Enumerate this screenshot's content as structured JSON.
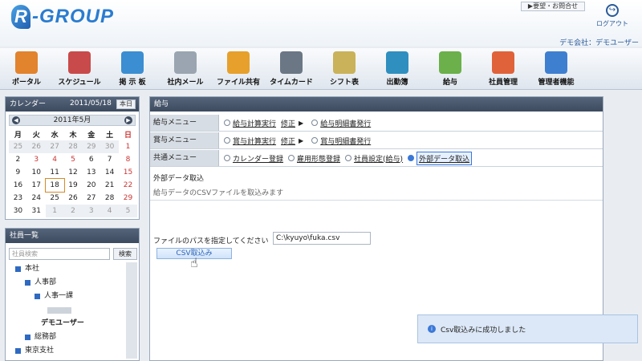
{
  "header": {
    "logo_mark": "R",
    "logo_text": "-GROUP",
    "request_link": "▶要望・お問合せ",
    "logout_label": "ログアウト",
    "company": "デモ会社：デモユーザー"
  },
  "nav": [
    {
      "label": "ポータル",
      "color": "#e2832d"
    },
    {
      "label": "スケジュール",
      "color": "#c94a4a"
    },
    {
      "label": "掲 示 板",
      "color": "#3b8ed1"
    },
    {
      "label": "社内メール",
      "color": "#9aa5b1"
    },
    {
      "label": "ファイル共有",
      "color": "#e6a02b"
    },
    {
      "label": "タイムカード",
      "color": "#6b7785"
    },
    {
      "label": "シフト表",
      "color": "#c9b25a"
    },
    {
      "label": "出勤簿",
      "color": "#2f8fbf"
    },
    {
      "label": "給与",
      "color": "#6bb04a"
    },
    {
      "label": "社員管理",
      "color": "#e0623a"
    },
    {
      "label": "管理者機能",
      "color": "#3f7fd0"
    }
  ],
  "calendar": {
    "title": "カレンダー",
    "date": "2011/05/18",
    "today_label": "本日",
    "month": "2011年5月",
    "weekdays": [
      "月",
      "火",
      "水",
      "木",
      "金",
      "土",
      "日"
    ],
    "weeks": [
      [
        "25",
        "26",
        "27",
        "28",
        "29",
        "30",
        "1"
      ],
      [
        "2",
        "3",
        "4",
        "5",
        "6",
        "7",
        "8"
      ],
      [
        "9",
        "10",
        "11",
        "12",
        "13",
        "14",
        "15"
      ],
      [
        "16",
        "17",
        "18",
        "19",
        "20",
        "21",
        "22"
      ],
      [
        "23",
        "24",
        "25",
        "26",
        "27",
        "28",
        "29"
      ],
      [
        "30",
        "31",
        "1",
        "2",
        "3",
        "4",
        "5"
      ]
    ]
  },
  "employees": {
    "title": "社員一覧",
    "search_placeholder": "社員検索",
    "search_button": "検索",
    "tree": [
      "本社",
      "人事部",
      "人事一課",
      "",
      "デモユーザー",
      "総務部",
      "東京支社"
    ]
  },
  "main": {
    "title": "給与",
    "rows": [
      {
        "label": "給与メニュー",
        "items": [
          "給与計算実行",
          "修正",
          "給与明細書発行"
        ]
      },
      {
        "label": "賞与メニュー",
        "items": [
          "賞与計算実行",
          "修正",
          "賞与明細書発行"
        ]
      },
      {
        "label": "共通メニュー",
        "items": [
          "カレンダー登録",
          "雇用形態登録",
          "社員設定(給与)",
          "外部データ取込"
        ]
      }
    ],
    "section_title": "外部データ取込",
    "section_sub": "給与データのCSVファイルを取込みます",
    "path_label": "ファイルのパスを指定してください",
    "path_value": "C:\\kyuyo\\fuka.csv",
    "csv_button": "CSV取込み",
    "toast": "Csv取込みに成功しました"
  }
}
